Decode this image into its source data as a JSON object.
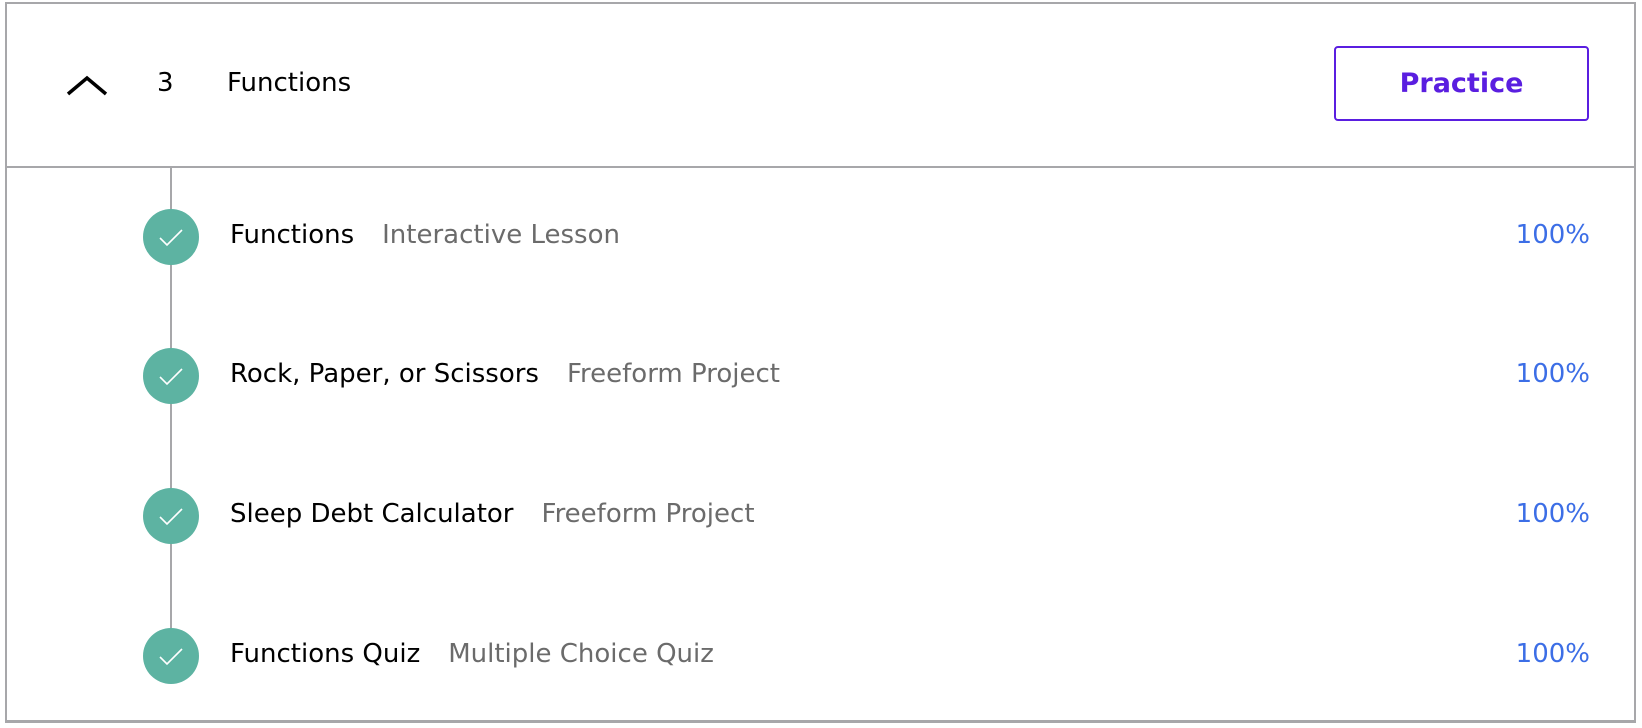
{
  "section": {
    "number": "3",
    "title": "Functions",
    "collapse_icon": "chevron-up-icon",
    "practice_label": "Practice",
    "accent_color": "#5a1ee0"
  },
  "items": [
    {
      "name": "Functions",
      "type": "Interactive Lesson",
      "progress": "100%",
      "status": "complete"
    },
    {
      "name": "Rock, Paper, or Scissors",
      "type": "Freeform Project",
      "progress": "100%",
      "status": "complete"
    },
    {
      "name": "Sleep Debt Calculator",
      "type": "Freeform Project",
      "progress": "100%",
      "status": "complete"
    },
    {
      "name": "Functions Quiz",
      "type": "Multiple Choice Quiz",
      "progress": "100%",
      "status": "complete"
    }
  ],
  "colors": {
    "complete": "#5db3a2",
    "progress_text": "#3c6ee6"
  }
}
